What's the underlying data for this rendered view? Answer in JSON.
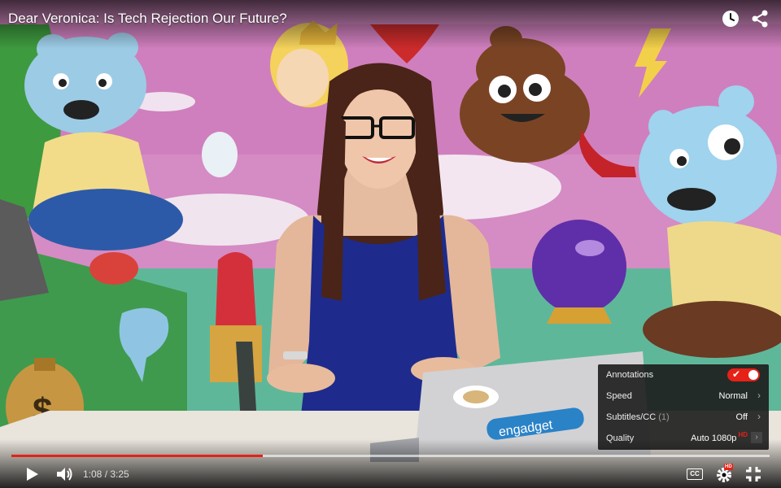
{
  "video": {
    "title": "Dear Veronica: Is Tech Rejection Our Future?"
  },
  "laptop_sticker": "engadget",
  "settings": {
    "annotations": {
      "label": "Annotations",
      "enabled": true
    },
    "speed": {
      "label": "Speed",
      "value": "Normal"
    },
    "subtitles": {
      "label": "Subtitles/CC",
      "count": "(1)",
      "value": "Off"
    },
    "quality": {
      "label": "Quality",
      "value": "Auto 1080p",
      "hd": "HD"
    }
  },
  "player": {
    "current_time": "1:08",
    "duration": "3:25",
    "time_display": "1:08 / 3:25",
    "played_fraction": 0.332,
    "loaded_fraction": 1.0,
    "cc_label": "CC",
    "hd_badge": "HD"
  },
  "colors": {
    "accent_red": "#e62117",
    "mural_pink": "#d88cc4",
    "dress_blue": "#1d2a8a"
  },
  "icons": {
    "watch_later": "clock-icon",
    "share": "share-icon",
    "play": "play-icon",
    "volume": "volume-icon",
    "settings": "gear-icon",
    "fullscreen": "fullscreen-icon"
  }
}
